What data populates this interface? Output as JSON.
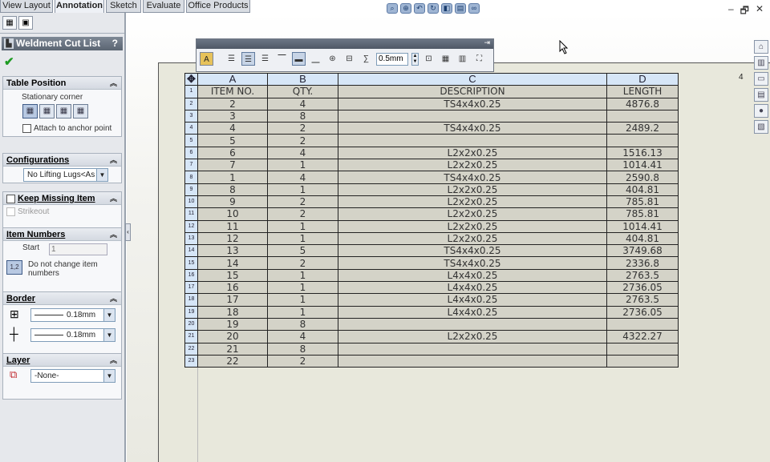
{
  "tabs": [
    {
      "label": "View Layout",
      "active": false
    },
    {
      "label": "Annotation",
      "active": true
    },
    {
      "label": "Sketch",
      "active": false
    },
    {
      "label": "Evaluate",
      "active": false
    },
    {
      "label": "Office Products",
      "active": false
    }
  ],
  "window_controls": {
    "minimize": "–",
    "restore": "🗗",
    "close": "✕"
  },
  "property_manager": {
    "title": "Weldment Cut List",
    "help": "?",
    "table_position": {
      "heading": "Table Position",
      "heading_u": "P",
      "stationary_corner": "Stationary corner",
      "attach_label": "Attach to anchor point"
    },
    "configurations": {
      "heading": "Configurations",
      "selected": "No Lifting Lugs<As M"
    },
    "keep_missing": {
      "heading": "Keep Missing Item",
      "strikeout": "Strikeout"
    },
    "item_numbers": {
      "heading": "Item Numbers",
      "start_label": "Start",
      "start_placeholder": "1",
      "option_icon": "1,2",
      "option_label": "Do not change item numbers"
    },
    "border": {
      "heading": "Border",
      "outer": "0.18mm",
      "inner": "0.18mm"
    },
    "layer": {
      "heading": "Layer",
      "selected": "-None-"
    }
  },
  "format_toolbar": {
    "font_size": "0.5mm"
  },
  "corner_number": "4",
  "table": {
    "columns": [
      "A",
      "B",
      "C",
      "D"
    ],
    "header_row": [
      "ITEM NO.",
      "QTY.",
      "DESCRIPTION",
      "LENGTH"
    ],
    "rows": [
      [
        "2",
        "4",
        "TS4x4x0.25",
        "4876.8"
      ],
      [
        "3",
        "8",
        "",
        ""
      ],
      [
        "4",
        "2",
        "TS4x4x0.25",
        "2489.2"
      ],
      [
        "5",
        "2",
        "",
        ""
      ],
      [
        "6",
        "4",
        "L2x2x0.25",
        "1516.13"
      ],
      [
        "7",
        "1",
        "L2x2x0.25",
        "1014.41"
      ],
      [
        "1",
        "4",
        "TS4x4x0.25",
        "2590.8"
      ],
      [
        "8",
        "1",
        "L2x2x0.25",
        "404.81"
      ],
      [
        "9",
        "2",
        "L2x2x0.25",
        "785.81"
      ],
      [
        "10",
        "2",
        "L2x2x0.25",
        "785.81"
      ],
      [
        "11",
        "1",
        "L2x2x0.25",
        "1014.41"
      ],
      [
        "12",
        "1",
        "L2x2x0.25",
        "404.81"
      ],
      [
        "13",
        "5",
        "TS4x4x0.25",
        "3749.68"
      ],
      [
        "14",
        "2",
        "TS4x4x0.25",
        "2336.8"
      ],
      [
        "15",
        "1",
        "L4x4x0.25",
        "2763.5"
      ],
      [
        "16",
        "1",
        "L4x4x0.25",
        "2736.05"
      ],
      [
        "17",
        "1",
        "L4x4x0.25",
        "2763.5"
      ],
      [
        "18",
        "1",
        "L4x4x0.25",
        "2736.05"
      ],
      [
        "19",
        "8",
        "",
        ""
      ],
      [
        "20",
        "4",
        "L2x2x0.25",
        "4322.27"
      ],
      [
        "21",
        "8",
        "",
        ""
      ],
      [
        "22",
        "2",
        "",
        ""
      ]
    ]
  }
}
